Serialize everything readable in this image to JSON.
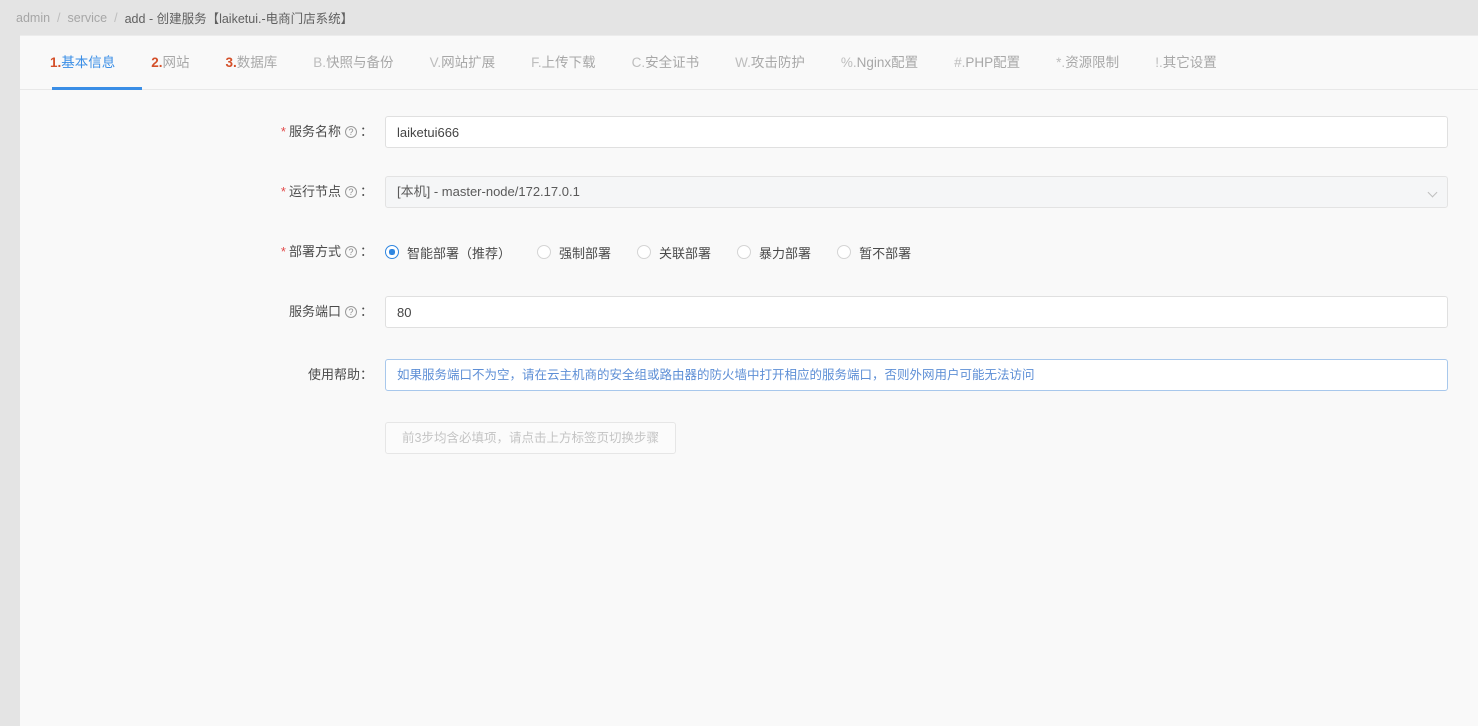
{
  "breadcrumb": {
    "root": "admin",
    "section": "service",
    "current": "add - 创建服务【laiketui.-电商门店系统】",
    "separator": "/"
  },
  "tabs": [
    {
      "prefix": "1.",
      "label": "基本信息",
      "numbered": true,
      "active": true
    },
    {
      "prefix": "2.",
      "label": "网站",
      "numbered": true,
      "active": false
    },
    {
      "prefix": "3.",
      "label": "数据库",
      "numbered": true,
      "active": false
    },
    {
      "prefix": "B.",
      "label": "快照与备份",
      "numbered": false,
      "active": false
    },
    {
      "prefix": "V.",
      "label": "网站扩展",
      "numbered": false,
      "active": false
    },
    {
      "prefix": "F.",
      "label": "上传下载",
      "numbered": false,
      "active": false
    },
    {
      "prefix": "C.",
      "label": "安全证书",
      "numbered": false,
      "active": false
    },
    {
      "prefix": "W.",
      "label": "攻击防护",
      "numbered": false,
      "active": false
    },
    {
      "prefix": "%.",
      "label": "Nginx配置",
      "numbered": false,
      "active": false
    },
    {
      "prefix": "#.",
      "label": "PHP配置",
      "numbered": false,
      "active": false
    },
    {
      "prefix": "*.",
      "label": "资源限制",
      "numbered": false,
      "active": false
    },
    {
      "prefix": "!.",
      "label": "其它设置",
      "numbered": false,
      "active": false
    }
  ],
  "form": {
    "help_icon_glyph": "?",
    "service_name": {
      "label": "服务名称",
      "required": true,
      "colon": "：",
      "value": "laiketui666",
      "placeholder": ""
    },
    "run_node": {
      "label": "运行节点",
      "required": true,
      "colon": "：",
      "value": "[本机] - master-node/172.17.0.1"
    },
    "deploy_mode": {
      "label": "部署方式",
      "required": true,
      "colon": "：",
      "selected": "智能部署（推荐）",
      "options": [
        "智能部署（推荐）",
        "强制部署",
        "关联部署",
        "暴力部署",
        "暂不部署"
      ]
    },
    "service_port": {
      "label": "服务端口",
      "required": false,
      "colon": "：",
      "value": "80",
      "placeholder": ""
    },
    "usage_help": {
      "label": "使用帮助",
      "colon": "：",
      "text": "如果服务端口不为空，请在云主机商的安全组或路由器的防火墙中打开相应的服务端口，否则外网用户可能无法访问"
    },
    "submit_button": {
      "label": "前3步均含必填项，请点击上方标签页切换步骤",
      "disabled": true
    }
  },
  "colors": {
    "accent_blue": "#3a8ee6",
    "accent_orange": "#d4502a",
    "required_red": "#e24a4a",
    "help_text_blue": "#5e8fd6",
    "page_bg": "#e4e4e4",
    "card_bg": "#f9f9f9"
  }
}
